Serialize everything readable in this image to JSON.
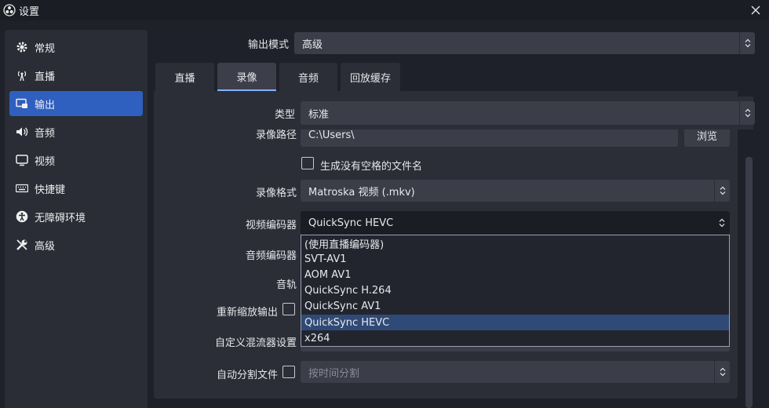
{
  "window": {
    "title": "设置"
  },
  "sidebar": {
    "items": [
      {
        "label": "常规",
        "icon": "gear-icon"
      },
      {
        "label": "直播",
        "icon": "antenna-icon"
      },
      {
        "label": "输出",
        "icon": "output-icon",
        "active": true
      },
      {
        "label": "音频",
        "icon": "speaker-icon"
      },
      {
        "label": "视频",
        "icon": "monitor-icon"
      },
      {
        "label": "快捷键",
        "icon": "keyboard-icon"
      },
      {
        "label": "无障碍环境",
        "icon": "accessibility-icon"
      },
      {
        "label": "高级",
        "icon": "wrench-icon"
      }
    ]
  },
  "output_mode": {
    "label": "输出模式",
    "value": "高级"
  },
  "tabs": [
    {
      "label": "直播"
    },
    {
      "label": "录像",
      "active": true
    },
    {
      "label": "音频"
    },
    {
      "label": "回放缓存"
    }
  ],
  "type_row": {
    "label": "类型",
    "value": "标准"
  },
  "recording": {
    "path_label": "录像路径",
    "path_value": "C:\\Users\\",
    "browse_label": "浏览",
    "no_space_label": "生成没有空格的文件名",
    "format_label": "录像格式",
    "format_value": "Matroska 视频 (.mkv)",
    "video_encoder_label": "视频编码器",
    "video_encoder_value": "QuickSync HEVC",
    "audio_encoder_label": "音频编码器",
    "audio_track_label": "音轨",
    "rescale_label": "重新缩放输出",
    "custom_mixer_label": "自定义混流器设置",
    "auto_split_label": "自动分割文件",
    "auto_split_value": "按时间分割"
  },
  "encoder_dropdown": {
    "options": [
      "(使用直播编码器)",
      "SVT-AV1",
      "AOM AV1",
      "QuickSync H.264",
      "QuickSync AV1",
      "QuickSync HEVC",
      "x264"
    ],
    "selected": "QuickSync HEVC"
  },
  "colors": {
    "accent": "#2f5fbf",
    "selection": "#2f4a76",
    "background": "#1f212a",
    "panel": "#2b2d37"
  }
}
